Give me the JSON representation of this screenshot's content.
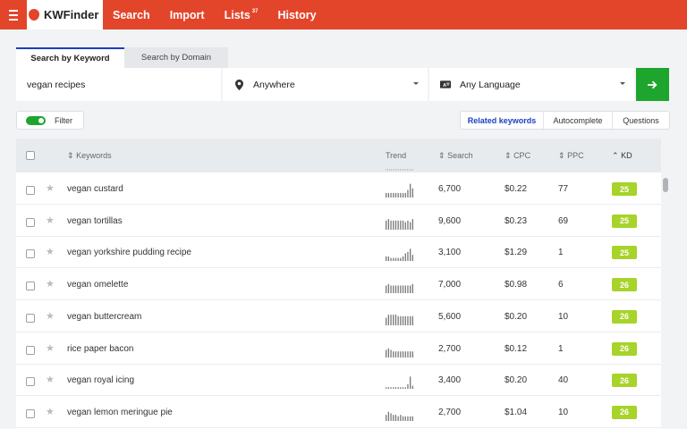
{
  "app": {
    "name": "KWFinder",
    "accent": "#e3452b",
    "primary": "#1ea52d",
    "kd_color": "#a7d32a"
  },
  "nav": {
    "items": [
      {
        "label": "Search"
      },
      {
        "label": "Import"
      },
      {
        "label": "Lists",
        "badge": "37"
      },
      {
        "label": "History"
      }
    ]
  },
  "search_tabs": {
    "by_keyword": "Search by Keyword",
    "by_domain": "Search by Domain"
  },
  "search": {
    "keyword": "vegan recipes",
    "location": "Anywhere",
    "language": "Any Language",
    "location_icon": "location-pin-icon",
    "language_icon": "translate-icon",
    "go_icon": "arrow-right-icon"
  },
  "filter": {
    "label": "Filter",
    "enabled": true
  },
  "modes": {
    "related": "Related keywords",
    "autocomplete": "Autocomplete",
    "questions": "Questions",
    "active": "related"
  },
  "table": {
    "headers": {
      "keywords": "Keywords",
      "trend": "Trend",
      "search": "Search",
      "cpc": "CPC",
      "ppc": "PPC",
      "kd": "KD"
    },
    "sorted_by": "kd",
    "rows": [
      {
        "keyword": "vegan custard",
        "search": "6,700",
        "cpc": "$0.22",
        "ppc": "77",
        "kd": "25",
        "trend": [
          3,
          3,
          3,
          3,
          3,
          3,
          3,
          3,
          3,
          5,
          9,
          6
        ]
      },
      {
        "keyword": "vegan tortillas",
        "search": "9,600",
        "cpc": "$0.23",
        "ppc": "69",
        "kd": "25",
        "trend": [
          6,
          7,
          6,
          6,
          6,
          6,
          6,
          6,
          5,
          6,
          5,
          7
        ]
      },
      {
        "keyword": "vegan yorkshire pudding recipe",
        "search": "3,100",
        "cpc": "$1.29",
        "ppc": "1",
        "kd": "25",
        "trend": [
          3,
          3,
          2,
          2,
          2,
          2,
          2,
          3,
          5,
          6,
          8,
          4
        ]
      },
      {
        "keyword": "vegan omelette",
        "search": "7,000",
        "cpc": "$0.98",
        "ppc": "6",
        "kd": "26",
        "trend": [
          5,
          6,
          5,
          5,
          5,
          5,
          5,
          5,
          5,
          5,
          5,
          6
        ]
      },
      {
        "keyword": "vegan buttercream",
        "search": "5,600",
        "cpc": "$0.20",
        "ppc": "10",
        "kd": "26",
        "trend": [
          5,
          7,
          7,
          7,
          7,
          6,
          6,
          6,
          6,
          6,
          6,
          6
        ]
      },
      {
        "keyword": "rice paper bacon",
        "search": "2,700",
        "cpc": "$0.12",
        "ppc": "1",
        "kd": "26",
        "trend": [
          5,
          6,
          5,
          4,
          4,
          4,
          4,
          4,
          4,
          4,
          4,
          4
        ]
      },
      {
        "keyword": "vegan royal icing",
        "search": "3,400",
        "cpc": "$0.20",
        "ppc": "40",
        "kd": "26",
        "trend": [
          1,
          1,
          1,
          1,
          1,
          1,
          1,
          1,
          1,
          3,
          8,
          2
        ]
      },
      {
        "keyword": "vegan lemon meringue pie",
        "search": "2,700",
        "cpc": "$1.04",
        "ppc": "10",
        "kd": "26",
        "trend": [
          4,
          6,
          5,
          4,
          4,
          3,
          4,
          3,
          3,
          3,
          3,
          3
        ]
      }
    ]
  }
}
